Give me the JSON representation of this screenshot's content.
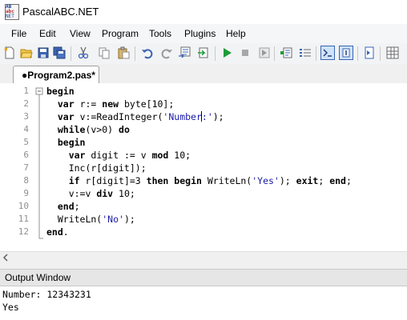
{
  "window": {
    "title": "PascalABC.NET",
    "icon_text": [
      "AB",
      "abc",
      "NET"
    ]
  },
  "menu": [
    "File",
    "Edit",
    "View",
    "Program",
    "Tools",
    "Plugins",
    "Help"
  ],
  "tab": {
    "label": "●Program2.pas*"
  },
  "code": {
    "line_numbers": [
      "1",
      "2",
      "3",
      "4",
      "5",
      "6",
      "7",
      "8",
      "9",
      "10",
      "11",
      "12"
    ],
    "lines": [
      [
        {
          "t": "begin",
          "k": "kw"
        }
      ],
      [
        {
          "t": "  "
        },
        {
          "t": "var",
          "k": "kw"
        },
        {
          "t": " r:= "
        },
        {
          "t": "new",
          "k": "kw"
        },
        {
          "t": " byte[10];"
        }
      ],
      [
        {
          "t": "  "
        },
        {
          "t": "var",
          "k": "kw"
        },
        {
          "t": " v:=ReadInteger("
        },
        {
          "t": "'Number",
          "k": "str"
        },
        {
          "caret": true
        },
        {
          "t": ":'",
          "k": "str"
        },
        {
          "t": ");"
        }
      ],
      [
        {
          "t": "  "
        },
        {
          "t": "while",
          "k": "kw"
        },
        {
          "t": "(v>0) "
        },
        {
          "t": "do",
          "k": "kw"
        }
      ],
      [
        {
          "t": "  "
        },
        {
          "t": "begin",
          "k": "kw"
        }
      ],
      [
        {
          "t": "    "
        },
        {
          "t": "var",
          "k": "kw"
        },
        {
          "t": " digit := v "
        },
        {
          "t": "mod",
          "k": "kw"
        },
        {
          "t": " 10;"
        }
      ],
      [
        {
          "t": "    Inc(r[digit]);"
        }
      ],
      [
        {
          "t": "    "
        },
        {
          "t": "if",
          "k": "kw"
        },
        {
          "t": " r[digit]=3 "
        },
        {
          "t": "then",
          "k": "kw"
        },
        {
          "t": " "
        },
        {
          "t": "begin",
          "k": "kw"
        },
        {
          "t": " WriteLn("
        },
        {
          "t": "'Yes'",
          "k": "str"
        },
        {
          "t": "); "
        },
        {
          "t": "exit",
          "k": "kw"
        },
        {
          "t": "; "
        },
        {
          "t": "end",
          "k": "kw"
        },
        {
          "t": ";"
        }
      ],
      [
        {
          "t": "    v:=v "
        },
        {
          "t": "div",
          "k": "kw"
        },
        {
          "t": " 10;"
        }
      ],
      [
        {
          "t": "  "
        },
        {
          "t": "end",
          "k": "kw"
        },
        {
          "t": ";"
        }
      ],
      [
        {
          "t": "  WriteLn("
        },
        {
          "t": "'No'",
          "k": "str"
        },
        {
          "t": ");"
        }
      ],
      [
        {
          "t": "end",
          "k": "kw"
        },
        {
          "t": "."
        }
      ]
    ]
  },
  "output": {
    "title": "Output Window",
    "lines": [
      "Number: 12343231",
      "Yes"
    ]
  },
  "colors": {
    "keyword": "#000000",
    "string": "#1a1aa6",
    "line_number": "#909090",
    "run_green": "#1f9a3a"
  }
}
